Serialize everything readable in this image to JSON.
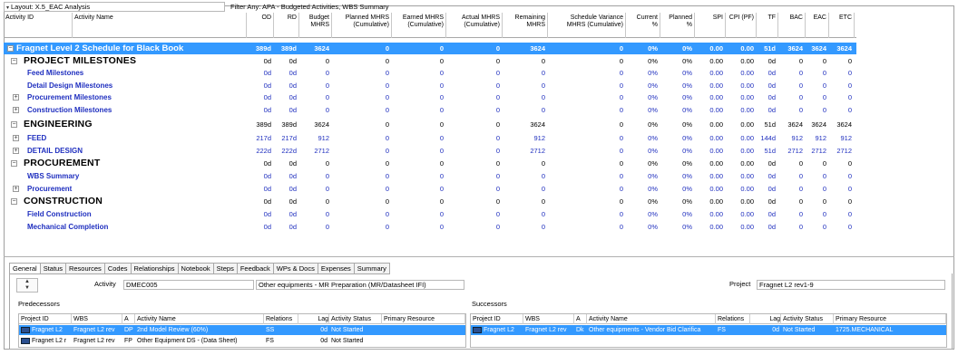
{
  "toolbar": {
    "layout_label": "Layout: X.5_EAC Analysis",
    "filter_label": "Filter Any: APA - Budgeted Activities, WBS Summary"
  },
  "columns": [
    {
      "key": "activity_id",
      "label": "Activity ID"
    },
    {
      "key": "activity_name",
      "label": "Activity Name"
    },
    {
      "key": "od",
      "label": "OD"
    },
    {
      "key": "rd",
      "label": "RD"
    },
    {
      "key": "budget",
      "label": "Budget\nMHRS"
    },
    {
      "key": "planned",
      "label": "Planned MHRS\n(Cumulative)"
    },
    {
      "key": "earned",
      "label": "Earned MHRS\n(Cumulative)"
    },
    {
      "key": "actual",
      "label": "Actual MHRS\n(Cumulative)"
    },
    {
      "key": "remaining",
      "label": "Remaining\nMHRS"
    },
    {
      "key": "schedvar",
      "label": "Schedule Variance\nMHRS (Cumulative)"
    },
    {
      "key": "current",
      "label": "Current\n%"
    },
    {
      "key": "plannedpct",
      "label": "Planned\n%"
    },
    {
      "key": "spi",
      "label": "SPI"
    },
    {
      "key": "cpi",
      "label": "CPI (PF)"
    },
    {
      "key": "tf",
      "label": "TF"
    },
    {
      "key": "bac",
      "label": "BAC"
    },
    {
      "key": "eac",
      "label": "EAC"
    },
    {
      "key": "etc",
      "label": "ETC"
    }
  ],
  "rows": [
    {
      "name": "Fragnet Level 2 Schedule for Black Book",
      "level": 0,
      "toggle": "-",
      "selected": true,
      "values": [
        "389d",
        "389d",
        "3624",
        "0",
        "0",
        "0",
        "3624",
        "0",
        "0%",
        "0%",
        "0.00",
        "0.00",
        "51d",
        "3624",
        "3624",
        "3624"
      ]
    },
    {
      "name": "PROJECT MILESTONES",
      "level": 1,
      "toggle": "-",
      "values": [
        "0d",
        "0d",
        "0",
        "0",
        "0",
        "0",
        "0",
        "0",
        "0%",
        "0%",
        "0.00",
        "0.00",
        "0d",
        "0",
        "0",
        "0"
      ]
    },
    {
      "name": "Feed Milestones",
      "level": 2,
      "toggle": "",
      "values": [
        "0d",
        "0d",
        "0",
        "0",
        "0",
        "0",
        "0",
        "0",
        "0%",
        "0%",
        "0.00",
        "0.00",
        "0d",
        "0",
        "0",
        "0"
      ]
    },
    {
      "name": "Detail Design Milestones",
      "level": 2,
      "toggle": "",
      "values": [
        "0d",
        "0d",
        "0",
        "0",
        "0",
        "0",
        "0",
        "0",
        "0%",
        "0%",
        "0.00",
        "0.00",
        "0d",
        "0",
        "0",
        "0"
      ]
    },
    {
      "name": "Procurement Milestones",
      "level": 2,
      "toggle": "+",
      "values": [
        "0d",
        "0d",
        "0",
        "0",
        "0",
        "0",
        "0",
        "0",
        "0%",
        "0%",
        "0.00",
        "0.00",
        "0d",
        "0",
        "0",
        "0"
      ]
    },
    {
      "name": "Construction Milestones",
      "level": 2,
      "toggle": "+",
      "values": [
        "0d",
        "0d",
        "0",
        "0",
        "0",
        "0",
        "0",
        "0",
        "0%",
        "0%",
        "0.00",
        "0.00",
        "0d",
        "0",
        "0",
        "0"
      ]
    },
    {
      "name": "ENGINEERING",
      "level": 1,
      "toggle": "-",
      "values": [
        "389d",
        "389d",
        "3624",
        "0",
        "0",
        "0",
        "3624",
        "0",
        "0%",
        "0%",
        "0.00",
        "0.00",
        "51d",
        "3624",
        "3624",
        "3624"
      ]
    },
    {
      "name": "FEED",
      "level": 2,
      "toggle": "+",
      "values": [
        "217d",
        "217d",
        "912",
        "0",
        "0",
        "0",
        "912",
        "0",
        "0%",
        "0%",
        "0.00",
        "0.00",
        "144d",
        "912",
        "912",
        "912"
      ]
    },
    {
      "name": "DETAIL DESIGN",
      "level": 2,
      "toggle": "+",
      "values": [
        "222d",
        "222d",
        "2712",
        "0",
        "0",
        "0",
        "2712",
        "0",
        "0%",
        "0%",
        "0.00",
        "0.00",
        "51d",
        "2712",
        "2712",
        "2712"
      ]
    },
    {
      "name": "PROCUREMENT",
      "level": 1,
      "toggle": "-",
      "values": [
        "0d",
        "0d",
        "0",
        "0",
        "0",
        "0",
        "0",
        "0",
        "0%",
        "0%",
        "0.00",
        "0.00",
        "0d",
        "0",
        "0",
        "0"
      ]
    },
    {
      "name": "WBS Summary",
      "level": 2,
      "toggle": "",
      "values": [
        "0d",
        "0d",
        "0",
        "0",
        "0",
        "0",
        "0",
        "0",
        "0%",
        "0%",
        "0.00",
        "0.00",
        "0d",
        "0",
        "0",
        "0"
      ]
    },
    {
      "name": "Procurement",
      "level": 2,
      "toggle": "+",
      "values": [
        "0d",
        "0d",
        "0",
        "0",
        "0",
        "0",
        "0",
        "0",
        "0%",
        "0%",
        "0.00",
        "0.00",
        "0d",
        "0",
        "0",
        "0"
      ]
    },
    {
      "name": "CONSTRUCTION",
      "level": 1,
      "toggle": "-",
      "values": [
        "0d",
        "0d",
        "0",
        "0",
        "0",
        "0",
        "0",
        "0",
        "0%",
        "0%",
        "0.00",
        "0.00",
        "0d",
        "0",
        "0",
        "0"
      ]
    },
    {
      "name": "Field Construction",
      "level": 2,
      "toggle": "",
      "values": [
        "0d",
        "0d",
        "0",
        "0",
        "0",
        "0",
        "0",
        "0",
        "0%",
        "0%",
        "0.00",
        "0.00",
        "0d",
        "0",
        "0",
        "0"
      ]
    },
    {
      "name": "Mechanical Completion",
      "level": 2,
      "toggle": "",
      "values": [
        "0d",
        "0d",
        "0",
        "0",
        "0",
        "0",
        "0",
        "0",
        "0%",
        "0%",
        "0.00",
        "0.00",
        "0d",
        "0",
        "0",
        "0"
      ]
    }
  ],
  "tabs": [
    "General",
    "Status",
    "Resources",
    "Codes",
    "Relationships",
    "Notebook",
    "Steps",
    "Feedback",
    "WPs & Docs",
    "Expenses",
    "Summary"
  ],
  "details": {
    "activity_label": "Activity",
    "activity_id": "DMEC005",
    "activity_name": "Other equipments - MR Preparation (MR/Datasheet IFI)",
    "project_label": "Project",
    "project_value": "Fragnet L2 rev1-9"
  },
  "predecessors": {
    "title": "Predecessors",
    "headers": [
      "Project ID",
      "WBS",
      "A",
      "Activity Name",
      "Relations",
      "Lag",
      "Activity Status",
      "Primary Resource"
    ],
    "rows": [
      {
        "selected": true,
        "cells": [
          "Fragnet L2",
          "Fragnet L2 rev",
          "DP",
          "2nd Model Review (60%)",
          "SS",
          "0d",
          "Not Started",
          ""
        ]
      },
      {
        "selected": false,
        "cells": [
          "Fragnet L2 r",
          "Fragnet L2 rev",
          "FP",
          "Other Equipment DS - (Data Sheet)",
          "FS",
          "0d",
          "Not Started",
          ""
        ]
      }
    ]
  },
  "successors": {
    "title": "Successors",
    "headers": [
      "Project ID",
      "WBS",
      "A",
      "Activity Name",
      "Relations",
      "Lag",
      "Activity Status",
      "Primary Resource"
    ],
    "rows": [
      {
        "selected": true,
        "cells": [
          "Fragnet L2",
          "Fragnet L2 rev",
          "Dk",
          "Other equipments - Vendor Bid Clarifica",
          "FS",
          "0d",
          "Not Started",
          "1725.MECHANICAL"
        ]
      }
    ]
  },
  "colors": {
    "selection": "#3399ff",
    "wbs_link": "#1f2fbf"
  }
}
